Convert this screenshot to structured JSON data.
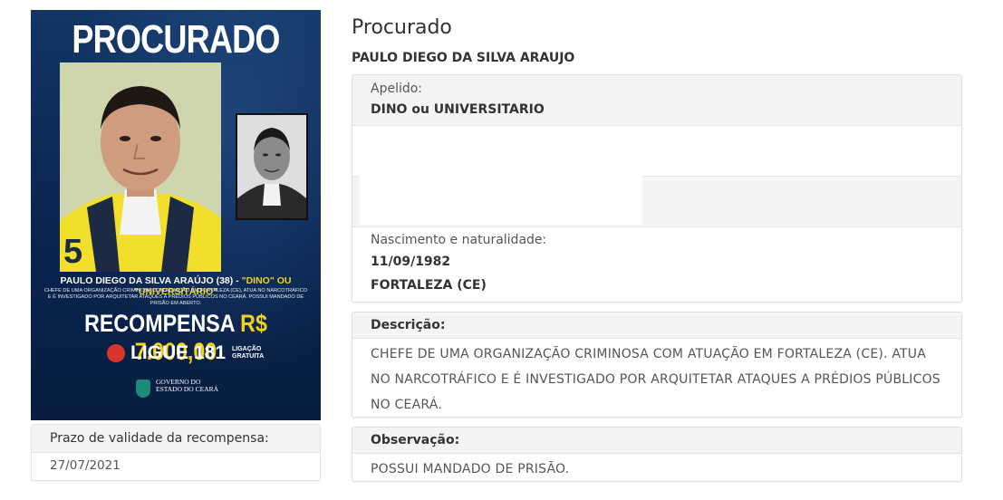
{
  "poster": {
    "heading": "PROCURADO",
    "name_line": "PAULO DIEGO DA SILVA ARAÚJO (38) -",
    "nickname_line": "\"DINO\" OU \"UNIVERSITÁRIO\"",
    "jersey_number": "5",
    "description": "CHEFE DE UMA ORGANIZAÇÃO CRIMINOSA COM ATUAÇÃO EM FORTALEZA (CE), ATUA NO NARCOTRÁFICO E É INVESTIGADO POR ARQUITETAR ATAQUES A PRÉDIOS PÚBLICOS NO CEARÁ. POSSUI MANDADO DE PRISÃO EM ABERTO.",
    "reward_label": "RECOMPENSA",
    "reward_amount": "R$ 7.000,00",
    "phone_label": "LIGUE 181",
    "phone_note": "LIGAÇÃO GRATUITA",
    "gov_line1": "GOVERNO DO",
    "gov_line2": "ESTADO DO CEARÁ",
    "colors": {
      "navy": "#0b2a57",
      "yellow": "#f2d21c",
      "red": "#d9352c"
    }
  },
  "reward_validity": {
    "label": "Prazo de validade da recompensa:",
    "value": "27/07/2021"
  },
  "page": {
    "title": "Procurado",
    "full_name": "PAULO DIEGO DA SILVA ARAUJO"
  },
  "details": {
    "alias_label": "Apelido:",
    "alias_value": "DINO ou UNIVERSITARIO",
    "birth_label": "Nascimento e naturalidade:",
    "birth_date": "11/09/1982",
    "birth_place": "FORTALEZA (CE)"
  },
  "description": {
    "label": "Descrição:",
    "text": "CHEFE DE UMA ORGANIZAÇÃO CRIMINOSA COM ATUAÇÃO EM FORTALEZA (CE). ATUA NO NARCOTRÁFICO E É INVESTIGADO POR ARQUITETAR ATAQUES A PRÉDIOS PÚBLICOS NO CEARÁ."
  },
  "observation": {
    "label": "Observação:",
    "text": "POSSUI MANDADO DE PRISÃO."
  }
}
